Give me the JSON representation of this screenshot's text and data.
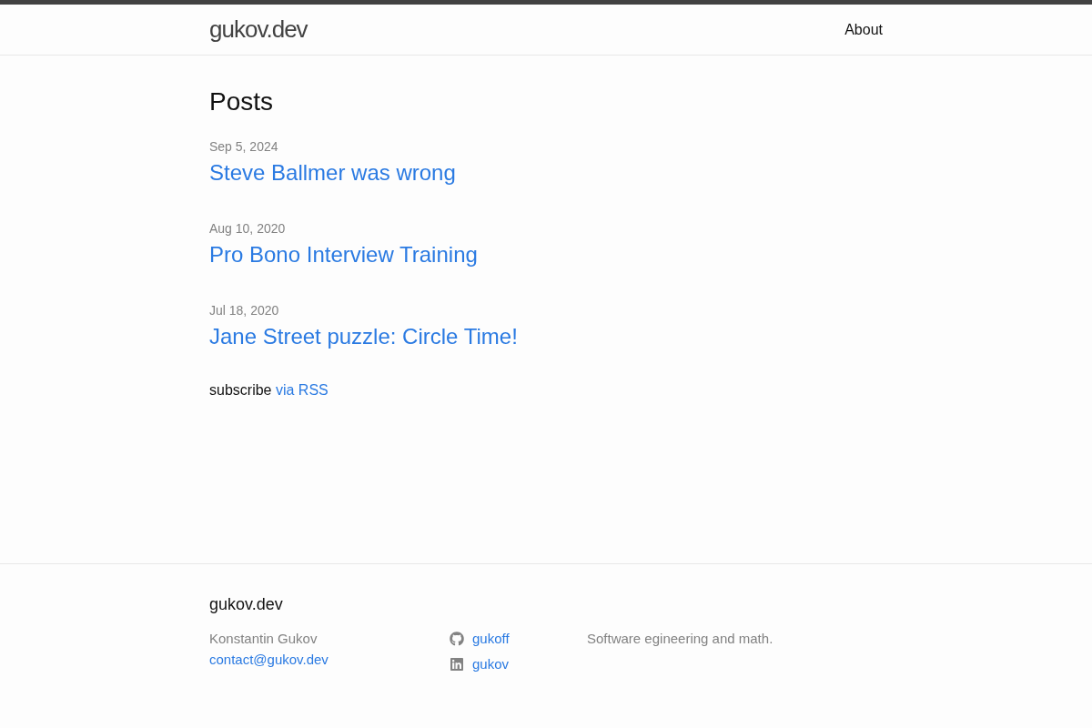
{
  "header": {
    "site_title": "gukov.dev",
    "nav": [
      {
        "label": "About"
      }
    ]
  },
  "posts": {
    "heading": "Posts",
    "items": [
      {
        "date": "Sep 5, 2024",
        "title": "Steve Ballmer was wrong"
      },
      {
        "date": "Aug 10, 2020",
        "title": "Pro Bono Interview Training"
      },
      {
        "date": "Jul 18, 2020",
        "title": "Jane Street puzzle: Circle Time!"
      }
    ],
    "subscribe": {
      "text": "subscribe",
      "link": "via RSS"
    }
  },
  "footer": {
    "title": "gukov.dev",
    "author": "Konstantin Gukov",
    "email": "contact@gukov.dev",
    "social": [
      {
        "kind": "github",
        "handle": "gukoff"
      },
      {
        "kind": "linkedin",
        "handle": "gukov"
      }
    ],
    "description": "Software egineering and math."
  }
}
